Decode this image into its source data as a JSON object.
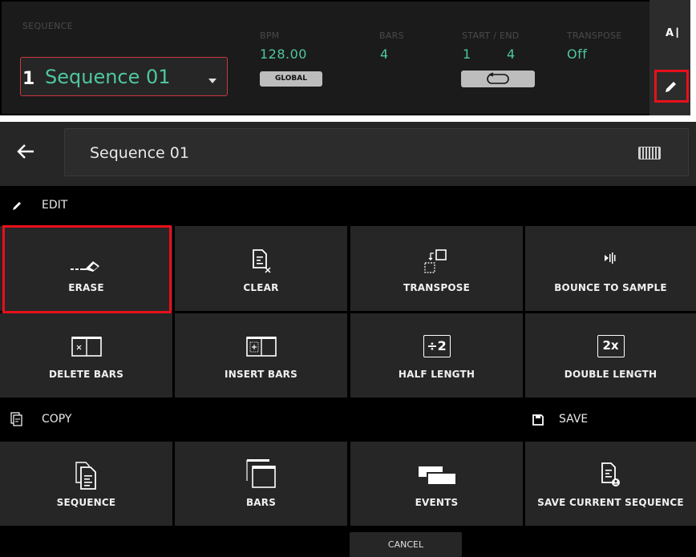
{
  "top": {
    "sequence_label": "SEQUENCE",
    "sequence_number": "1",
    "sequence_name": "Sequence 01",
    "bpm_label": "BPM",
    "bpm_value": "128.00",
    "global_label": "GLOBAL",
    "bars_label": "BARS",
    "bars_value": "4",
    "start_end_label": "START / END",
    "start_value": "1",
    "end_value": "4",
    "transpose_label": "TRANSPOSE",
    "transpose_value": "Off",
    "rename_icon_label": "A"
  },
  "header": {
    "title": "Sequence 01"
  },
  "edit_section": {
    "label": "EDIT",
    "buttons": [
      "ERASE",
      "CLEAR",
      "TRANSPOSE",
      "BOUNCE TO SAMPLE",
      "DELETE BARS",
      "INSERT BARS",
      "HALF LENGTH",
      "DOUBLE LENGTH"
    ],
    "half_icon": "÷2",
    "double_icon": "2x"
  },
  "copy_section": {
    "label": "COPY",
    "save_label": "SAVE",
    "buttons": [
      "SEQUENCE",
      "BARS",
      "EVENTS",
      "SAVE CURRENT SEQUENCE"
    ]
  },
  "footer": {
    "cancel_label": "CANCEL"
  },
  "colors": {
    "accent": "#4ec7a0",
    "highlight": "#e8101a",
    "panel": "#262626"
  }
}
